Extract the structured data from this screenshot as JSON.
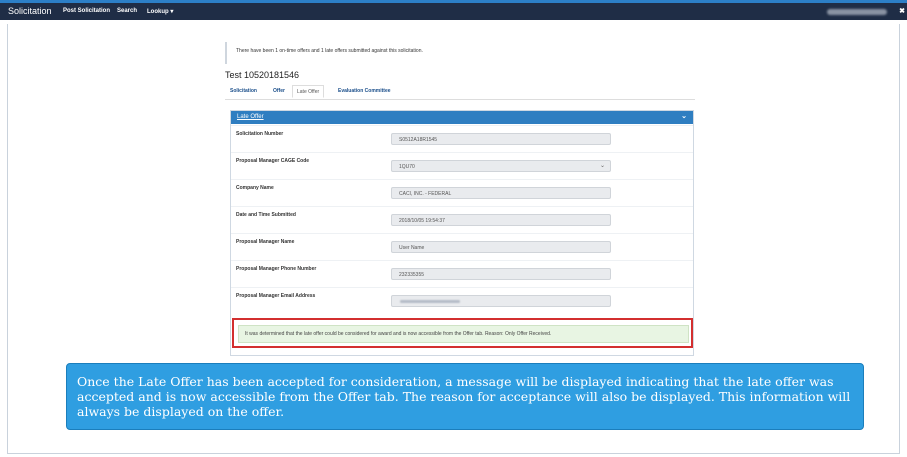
{
  "navbar": {
    "brand": "Solicitation",
    "items": [
      "Post Solicitation",
      "Search",
      "Lookup ▾"
    ]
  },
  "info": {
    "text": "There have been 1 on-time offers and 1 late offers submitted against this solicitation."
  },
  "solicitation_title": "Test 10520181546",
  "tabs": [
    "Solicitation",
    "Offer",
    "Late Offer",
    "Evaluation Committee"
  ],
  "panel": {
    "title": "Late Offer",
    "fields": [
      {
        "label": "Solicitation Number",
        "value": "S0512A18R1545"
      },
      {
        "label": "Proposal Manager CAGE Code",
        "value": "1QU70"
      },
      {
        "label": "Company Name",
        "value": "CACI, INC. - FEDERAL"
      },
      {
        "label": "Date and Time Submitted",
        "value": "2018/10/05 19:54:37"
      },
      {
        "label": "Proposal Manager Name",
        "value": "User Name"
      },
      {
        "label": "Proposal Manager Phone Number",
        "value": "232335355"
      },
      {
        "label": "Proposal Manager Email Address",
        "value": ""
      }
    ]
  },
  "alert": {
    "text": "It was determined that the late offer could be considered for award and is now accessible from the Offer tab. Reason: Only Offer Received."
  },
  "callout": {
    "text": "Once the Late Offer has been accepted for consideration, a message will be displayed indicating that the late offer was accepted and is now accessible from the Offer tab. The reason for acceptance will also be displayed. This information will always be displayed on the offer."
  },
  "colors": {
    "navbar": "#1f2d46",
    "accent": "#2f7ec1",
    "callout": "#2f9ee1",
    "alert_border": "#d32f2f",
    "alert_bg": "#e8f5e3"
  }
}
